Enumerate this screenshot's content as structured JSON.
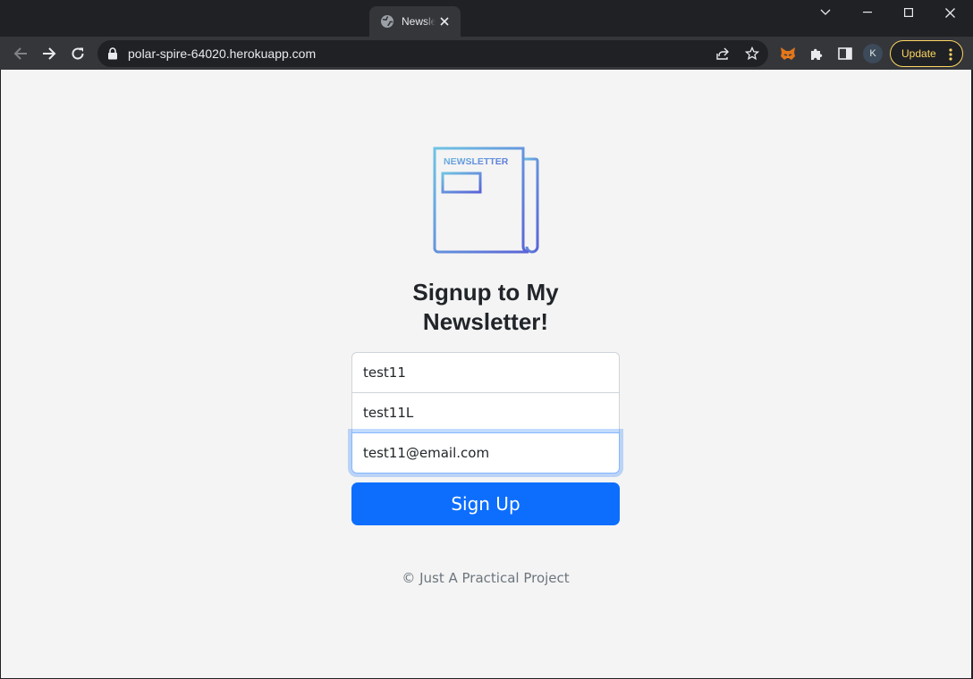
{
  "browser": {
    "tab": {
      "title": "Newsletter",
      "favicon": "globe-icon"
    },
    "window_controls": [
      "chevron-down-icon",
      "minimize-icon",
      "maximize-icon",
      "close-icon"
    ],
    "url": "polar-spire-64020.herokuapp.com",
    "profile_initial": "K",
    "update_label": "Update",
    "accent_update": "#fdd663"
  },
  "page": {
    "logo_text": "NEWSLETTER",
    "heading": "Signup to My Newsletter!",
    "form": {
      "first_name": "test11",
      "last_name": "test11L",
      "email": "test11@email.com"
    },
    "signup_label": "Sign Up",
    "footer": "© Just A Practical Project",
    "colors": {
      "primary": "#0d6efd",
      "background": "#f4f4f4"
    }
  }
}
